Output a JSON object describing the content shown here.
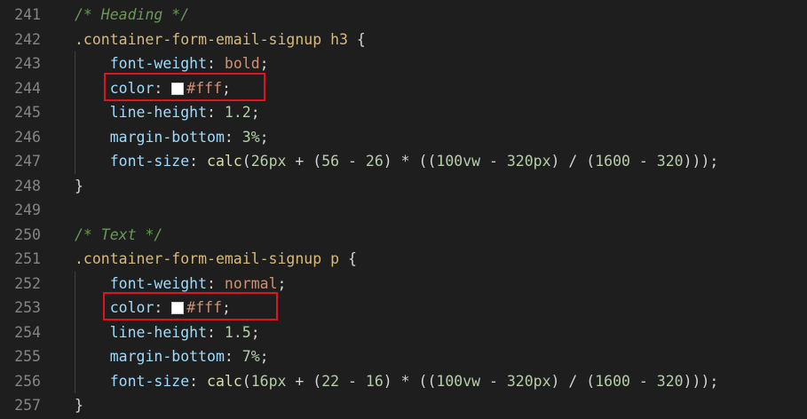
{
  "lines": [
    {
      "num": "241",
      "indent": false,
      "tokens": [
        {
          "t": "comment",
          "v": "/* Heading */"
        }
      ]
    },
    {
      "num": "242",
      "indent": false,
      "tokens": [
        {
          "t": "selector",
          "v": ".container-form-email-signup h3"
        },
        {
          "t": "punct",
          "v": " {"
        }
      ]
    },
    {
      "num": "243",
      "indent": true,
      "tokens": [
        {
          "t": "prop",
          "v": "font-weight"
        },
        {
          "t": "punct",
          "v": ": "
        },
        {
          "t": "value",
          "v": "bold"
        },
        {
          "t": "punct",
          "v": ";"
        }
      ]
    },
    {
      "num": "244",
      "indent": true,
      "tokens": [
        {
          "t": "prop",
          "v": "color"
        },
        {
          "t": "punct",
          "v": ": "
        },
        {
          "t": "swatch",
          "v": "#ffffff"
        },
        {
          "t": "value",
          "v": "#fff"
        },
        {
          "t": "punct",
          "v": ";"
        }
      ]
    },
    {
      "num": "245",
      "indent": true,
      "tokens": [
        {
          "t": "prop",
          "v": "line-height"
        },
        {
          "t": "punct",
          "v": ": "
        },
        {
          "t": "num",
          "v": "1.2"
        },
        {
          "t": "punct",
          "v": ";"
        }
      ]
    },
    {
      "num": "246",
      "indent": true,
      "tokens": [
        {
          "t": "prop",
          "v": "margin-bottom"
        },
        {
          "t": "punct",
          "v": ": "
        },
        {
          "t": "num",
          "v": "3%"
        },
        {
          "t": "punct",
          "v": ";"
        }
      ]
    },
    {
      "num": "247",
      "indent": true,
      "tokens": [
        {
          "t": "prop",
          "v": "font-size"
        },
        {
          "t": "punct",
          "v": ": "
        },
        {
          "t": "func",
          "v": "calc"
        },
        {
          "t": "punct",
          "v": "("
        },
        {
          "t": "num",
          "v": "26px"
        },
        {
          "t": "punct",
          "v": " + ("
        },
        {
          "t": "num",
          "v": "56"
        },
        {
          "t": "punct",
          "v": " - "
        },
        {
          "t": "num",
          "v": "26"
        },
        {
          "t": "punct",
          "v": ") * (("
        },
        {
          "t": "num",
          "v": "100vw"
        },
        {
          "t": "punct",
          "v": " - "
        },
        {
          "t": "num",
          "v": "320px"
        },
        {
          "t": "punct",
          "v": ") / ("
        },
        {
          "t": "num",
          "v": "1600"
        },
        {
          "t": "punct",
          "v": " - "
        },
        {
          "t": "num",
          "v": "320"
        },
        {
          "t": "punct",
          "v": ")));"
        }
      ]
    },
    {
      "num": "248",
      "indent": false,
      "tokens": [
        {
          "t": "punct",
          "v": "}"
        }
      ]
    },
    {
      "num": "249",
      "indent": false,
      "tokens": []
    },
    {
      "num": "250",
      "indent": false,
      "tokens": [
        {
          "t": "comment",
          "v": "/* Text */"
        }
      ]
    },
    {
      "num": "251",
      "indent": false,
      "tokens": [
        {
          "t": "selector",
          "v": ".container-form-email-signup p"
        },
        {
          "t": "punct",
          "v": " {"
        }
      ]
    },
    {
      "num": "252",
      "indent": true,
      "tokens": [
        {
          "t": "prop",
          "v": "font-weight"
        },
        {
          "t": "punct",
          "v": ": "
        },
        {
          "t": "value",
          "v": "normal"
        },
        {
          "t": "punct",
          "v": ";"
        }
      ]
    },
    {
      "num": "253",
      "indent": true,
      "tokens": [
        {
          "t": "prop",
          "v": "color"
        },
        {
          "t": "punct",
          "v": ": "
        },
        {
          "t": "swatch",
          "v": "#ffffff"
        },
        {
          "t": "value",
          "v": "#fff"
        },
        {
          "t": "punct",
          "v": ";"
        }
      ]
    },
    {
      "num": "254",
      "indent": true,
      "tokens": [
        {
          "t": "prop",
          "v": "line-height"
        },
        {
          "t": "punct",
          "v": ": "
        },
        {
          "t": "num",
          "v": "1.5"
        },
        {
          "t": "punct",
          "v": ";"
        }
      ]
    },
    {
      "num": "255",
      "indent": true,
      "tokens": [
        {
          "t": "prop",
          "v": "margin-bottom"
        },
        {
          "t": "punct",
          "v": ": "
        },
        {
          "t": "num",
          "v": "7%"
        },
        {
          "t": "punct",
          "v": ";"
        }
      ]
    },
    {
      "num": "256",
      "indent": true,
      "tokens": [
        {
          "t": "prop",
          "v": "font-size"
        },
        {
          "t": "punct",
          "v": ": "
        },
        {
          "t": "func",
          "v": "calc"
        },
        {
          "t": "punct",
          "v": "("
        },
        {
          "t": "num",
          "v": "16px"
        },
        {
          "t": "punct",
          "v": " + ("
        },
        {
          "t": "num",
          "v": "22"
        },
        {
          "t": "punct",
          "v": " - "
        },
        {
          "t": "num",
          "v": "16"
        },
        {
          "t": "punct",
          "v": ") * (("
        },
        {
          "t": "num",
          "v": "100vw"
        },
        {
          "t": "punct",
          "v": " - "
        },
        {
          "t": "num",
          "v": "320px"
        },
        {
          "t": "punct",
          "v": ") / ("
        },
        {
          "t": "num",
          "v": "1600"
        },
        {
          "t": "punct",
          "v": " - "
        },
        {
          "t": "num",
          "v": "320"
        },
        {
          "t": "punct",
          "v": ")));"
        }
      ]
    },
    {
      "num": "257",
      "indent": false,
      "tokens": [
        {
          "t": "punct",
          "v": "}"
        }
      ]
    }
  ],
  "highlights": [
    {
      "line": "244",
      "color": "#e0141e"
    },
    {
      "line": "253",
      "color": "#e0141e"
    }
  ],
  "colors": {
    "background": "#1e1e1e",
    "line_number": "#858585",
    "comment": "#6a9955",
    "selector": "#d7ba7d",
    "property": "#9cdcfe",
    "value": "#ce9178",
    "number": "#b5cea8",
    "function": "#dcdcaa"
  }
}
